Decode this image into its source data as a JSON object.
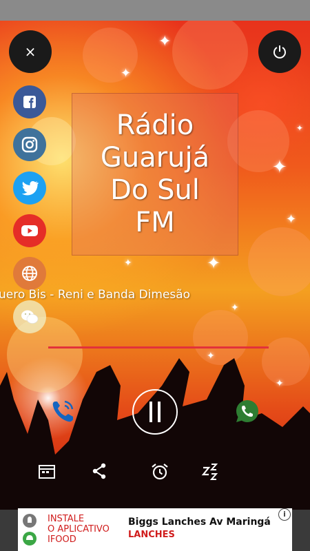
{
  "player": {
    "station_logo_lines": [
      "Rádio",
      "Guarujá",
      "Do Sul",
      "FM"
    ],
    "now_playing": "uero Bis - Reni e Banda Dimesão",
    "close_label": "×"
  },
  "social_icons": [
    "facebook-icon",
    "instagram-icon",
    "twitter-icon",
    "youtube-icon",
    "website-globe-icon",
    "wechat-icon"
  ],
  "controls": [
    "call-icon",
    "play-pause-icon",
    "whatsapp-icon",
    "schedule-icon",
    "share-icon",
    "alarm-icon",
    "sleep-timer-icon"
  ],
  "ad": {
    "brand_lines": [
      "INSTALE",
      "O APLICATIVO",
      "IFOOD"
    ],
    "title": "Biggs Lanches Av Maringá",
    "category": "LANCHES",
    "info_label": "i"
  },
  "colors": {
    "accent_red": "#e2323a",
    "facebook": "#3b5998",
    "instagram": "#3f729b",
    "twitter": "#1da1f2",
    "youtube": "#e52d27",
    "web": "#e07a3a",
    "wechat": "#f0f0c8",
    "whatsapp": "#2e7d32",
    "call": "#1565c0"
  }
}
